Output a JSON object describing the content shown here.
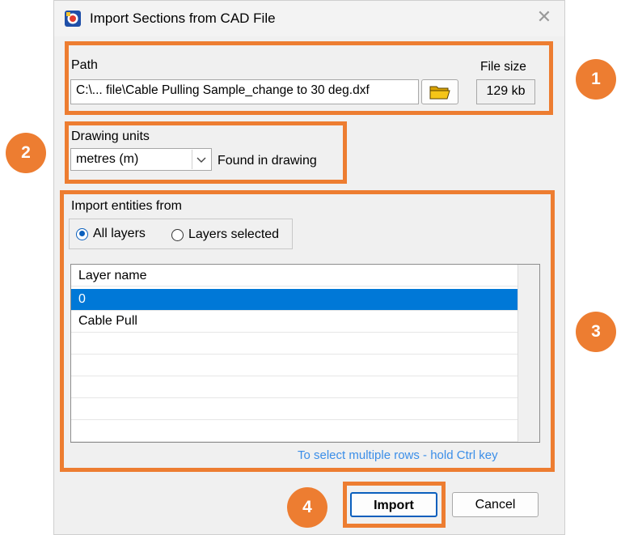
{
  "window": {
    "title": "Import Sections from CAD File",
    "app_icon": "cad-import-app-icon",
    "close_icon": "close-icon"
  },
  "path_section": {
    "label": "Path",
    "value": "C:\\... file\\Cable Pulling Sample_change to 30 deg.dxf",
    "browse_icon": "folder-open-icon",
    "file_size_label": "File size",
    "file_size_value": "129 kb"
  },
  "units_section": {
    "label": "Drawing units",
    "selected": "metres (m)",
    "status": "Found in drawing"
  },
  "import_section": {
    "label": "Import entities from",
    "options": [
      {
        "label": "All layers",
        "checked": true
      },
      {
        "label": "Layers selected",
        "checked": false
      }
    ],
    "grid": {
      "column": "Layer name",
      "rows": [
        {
          "name": "0",
          "selected": true
        },
        {
          "name": "Cable Pull",
          "selected": false
        }
      ]
    },
    "hint": "To select multiple rows - hold Ctrl key"
  },
  "buttons": {
    "import": "Import",
    "cancel": "Cancel"
  },
  "callouts": [
    "1",
    "2",
    "3",
    "4"
  ],
  "colors": {
    "highlight": "#ed7d31",
    "selection": "#0078d7",
    "hint": "#3b8ee8"
  }
}
